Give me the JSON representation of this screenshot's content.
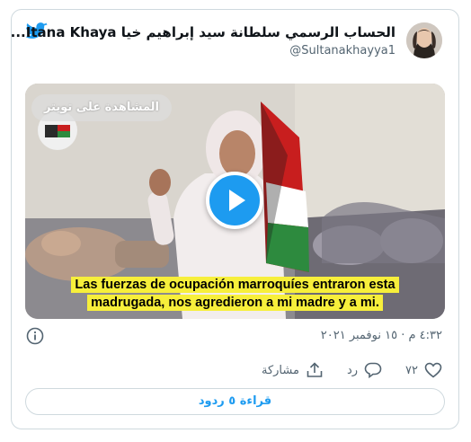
{
  "tweet": {
    "display_name": "الحساب الرسمي سلطانة سيد إبراهيم خيا Itana Khaya...",
    "handle": "@Sultanakhayya1",
    "timestamp": "٤:٣٢ م · ١٥ نوفمبر ٢٠٢١",
    "watch_on_twitter": "المشاهدة على تويتر",
    "subtitle_line1": "Las fuerzas de ocupación marroquíes entraron esta",
    "subtitle_line2": "madrugada, nos agredieron a mi madre y a mi.",
    "likes_count": "٧٢",
    "reply_label": "رد",
    "share_label": "مشاركة",
    "read_replies": "قراءة ٥ ردود"
  },
  "colors": {
    "accent": "#1d9bf0",
    "like_icon": "#536471",
    "subtitle_highlight": "#f7ef3b"
  }
}
